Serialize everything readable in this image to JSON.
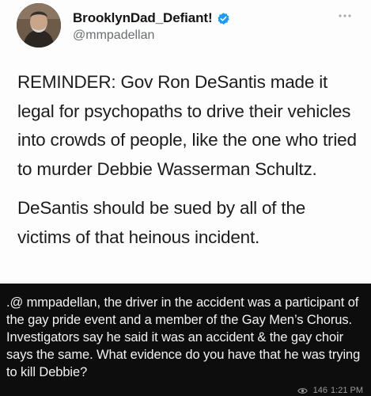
{
  "tweet": {
    "display_name": "BrooklynDad_Defiant!",
    "handle": "@mmpadellan",
    "verified_icon": "verified-badge-icon",
    "more_icon": "more-options-icon",
    "paragraphs": [
      "REMINDER: Gov Ron DeSantis made it legal for psychopaths to drive their vehicles into crowds of people, like the one who tried to murder Debbie Wasserman Schultz.",
      "DeSantis should be sued by all of the victims of that heinous incident."
    ]
  },
  "reply": {
    "text": ".@ mmpadellan, the driver in the accident was a participant of the gay pride event and a member of the Gay Men’s Chorus. Investigators say he said it was an accident & the gay choir says the same. What evidence do you have that he was trying to kill Debbie?",
    "views": "146",
    "time": "1:21 PM",
    "views_icon": "eye-icon"
  },
  "colors": {
    "verified": "#1d9bf0",
    "reply_background": "#0d0d0d",
    "handle": "#6b6f73"
  }
}
